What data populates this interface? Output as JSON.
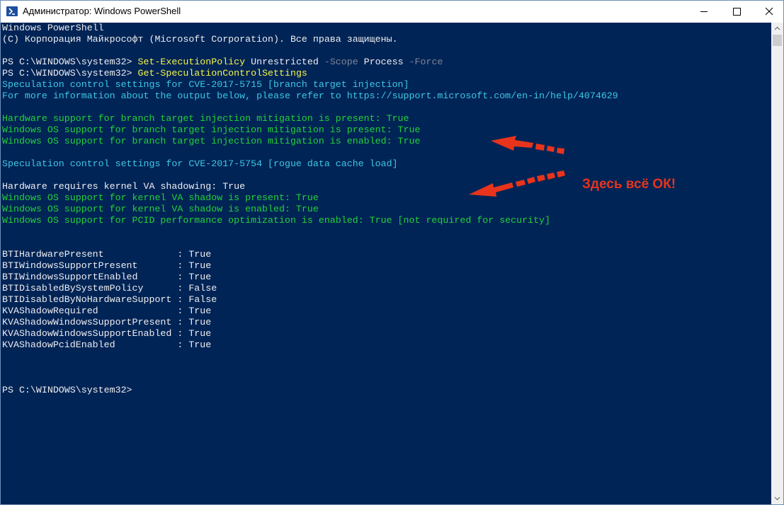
{
  "window": {
    "title": "Администратор: Windows PowerShell",
    "icon": "powershell-icon",
    "accent": "#012456"
  },
  "console": {
    "lines": [
      {
        "parts": [
          {
            "text": "Windows PowerShell",
            "color": "default"
          }
        ]
      },
      {
        "parts": [
          {
            "text": "(C) Корпорация Майкрософт (Microsoft Corporation). Все права защищены.",
            "color": "default"
          }
        ]
      },
      {
        "parts": [
          {
            "text": "",
            "color": "default"
          }
        ]
      },
      {
        "parts": [
          {
            "text": "PS C:\\WINDOWS\\system32> ",
            "color": "default"
          },
          {
            "text": "Set-ExecutionPolicy",
            "color": "yellow"
          },
          {
            "text": " Unrestricted ",
            "color": "default"
          },
          {
            "text": "-Scope",
            "color": "gray"
          },
          {
            "text": " Process ",
            "color": "default"
          },
          {
            "text": "-Force",
            "color": "gray"
          }
        ]
      },
      {
        "parts": [
          {
            "text": "PS C:\\WINDOWS\\system32> ",
            "color": "default"
          },
          {
            "text": "Get-SpeculationControlSettings",
            "color": "yellow"
          }
        ]
      },
      {
        "parts": [
          {
            "text": "Speculation control settings for CVE-2017-5715 [branch target injection]",
            "color": "cyan"
          }
        ]
      },
      {
        "parts": [
          {
            "text": "For more information about the output below, please refer to https://support.microsoft.com/en-in/help/4074629",
            "color": "cyan"
          }
        ]
      },
      {
        "parts": [
          {
            "text": "",
            "color": "default"
          }
        ]
      },
      {
        "parts": [
          {
            "text": "Hardware support for branch target injection mitigation is present: True",
            "color": "green"
          }
        ]
      },
      {
        "parts": [
          {
            "text": "Windows OS support for branch target injection mitigation is present: True",
            "color": "green"
          }
        ]
      },
      {
        "parts": [
          {
            "text": "Windows OS support for branch target injection mitigation is enabled: True",
            "color": "green"
          }
        ]
      },
      {
        "parts": [
          {
            "text": "",
            "color": "default"
          }
        ]
      },
      {
        "parts": [
          {
            "text": "Speculation control settings for CVE-2017-5754 [rogue data cache load]",
            "color": "cyan"
          }
        ]
      },
      {
        "parts": [
          {
            "text": "",
            "color": "default"
          }
        ]
      },
      {
        "parts": [
          {
            "text": "Hardware requires kernel VA shadowing: True",
            "color": "default"
          }
        ]
      },
      {
        "parts": [
          {
            "text": "Windows OS support for kernel VA shadow is present: True",
            "color": "green"
          }
        ]
      },
      {
        "parts": [
          {
            "text": "Windows OS support for kernel VA shadow is enabled: True",
            "color": "green"
          }
        ]
      },
      {
        "parts": [
          {
            "text": "Windows OS support for PCID performance optimization is enabled: True [not required for security]",
            "color": "green"
          }
        ]
      },
      {
        "parts": [
          {
            "text": "",
            "color": "default"
          }
        ]
      },
      {
        "parts": [
          {
            "text": "",
            "color": "default"
          }
        ]
      },
      {
        "parts": [
          {
            "text": "BTIHardwarePresent             : True",
            "color": "default"
          }
        ]
      },
      {
        "parts": [
          {
            "text": "BTIWindowsSupportPresent       : True",
            "color": "default"
          }
        ]
      },
      {
        "parts": [
          {
            "text": "BTIWindowsSupportEnabled       : True",
            "color": "default"
          }
        ]
      },
      {
        "parts": [
          {
            "text": "BTIDisabledBySystemPolicy      : False",
            "color": "default"
          }
        ]
      },
      {
        "parts": [
          {
            "text": "BTIDisabledByNoHardwareSupport : False",
            "color": "default"
          }
        ]
      },
      {
        "parts": [
          {
            "text": "KVAShadowRequired              : True",
            "color": "default"
          }
        ]
      },
      {
        "parts": [
          {
            "text": "KVAShadowWindowsSupportPresent : True",
            "color": "default"
          }
        ]
      },
      {
        "parts": [
          {
            "text": "KVAShadowWindowsSupportEnabled : True",
            "color": "default"
          }
        ]
      },
      {
        "parts": [
          {
            "text": "KVAShadowPcidEnabled           : True",
            "color": "default"
          }
        ]
      },
      {
        "parts": [
          {
            "text": "",
            "color": "default"
          }
        ]
      },
      {
        "parts": [
          {
            "text": "",
            "color": "default"
          }
        ]
      },
      {
        "parts": [
          {
            "text": "",
            "color": "default"
          }
        ]
      },
      {
        "parts": [
          {
            "text": "PS C:\\WINDOWS\\system32>",
            "color": "default"
          }
        ]
      }
    ]
  },
  "annotation": {
    "text": "Здесь всё ОК!",
    "color": "#e8341c"
  }
}
